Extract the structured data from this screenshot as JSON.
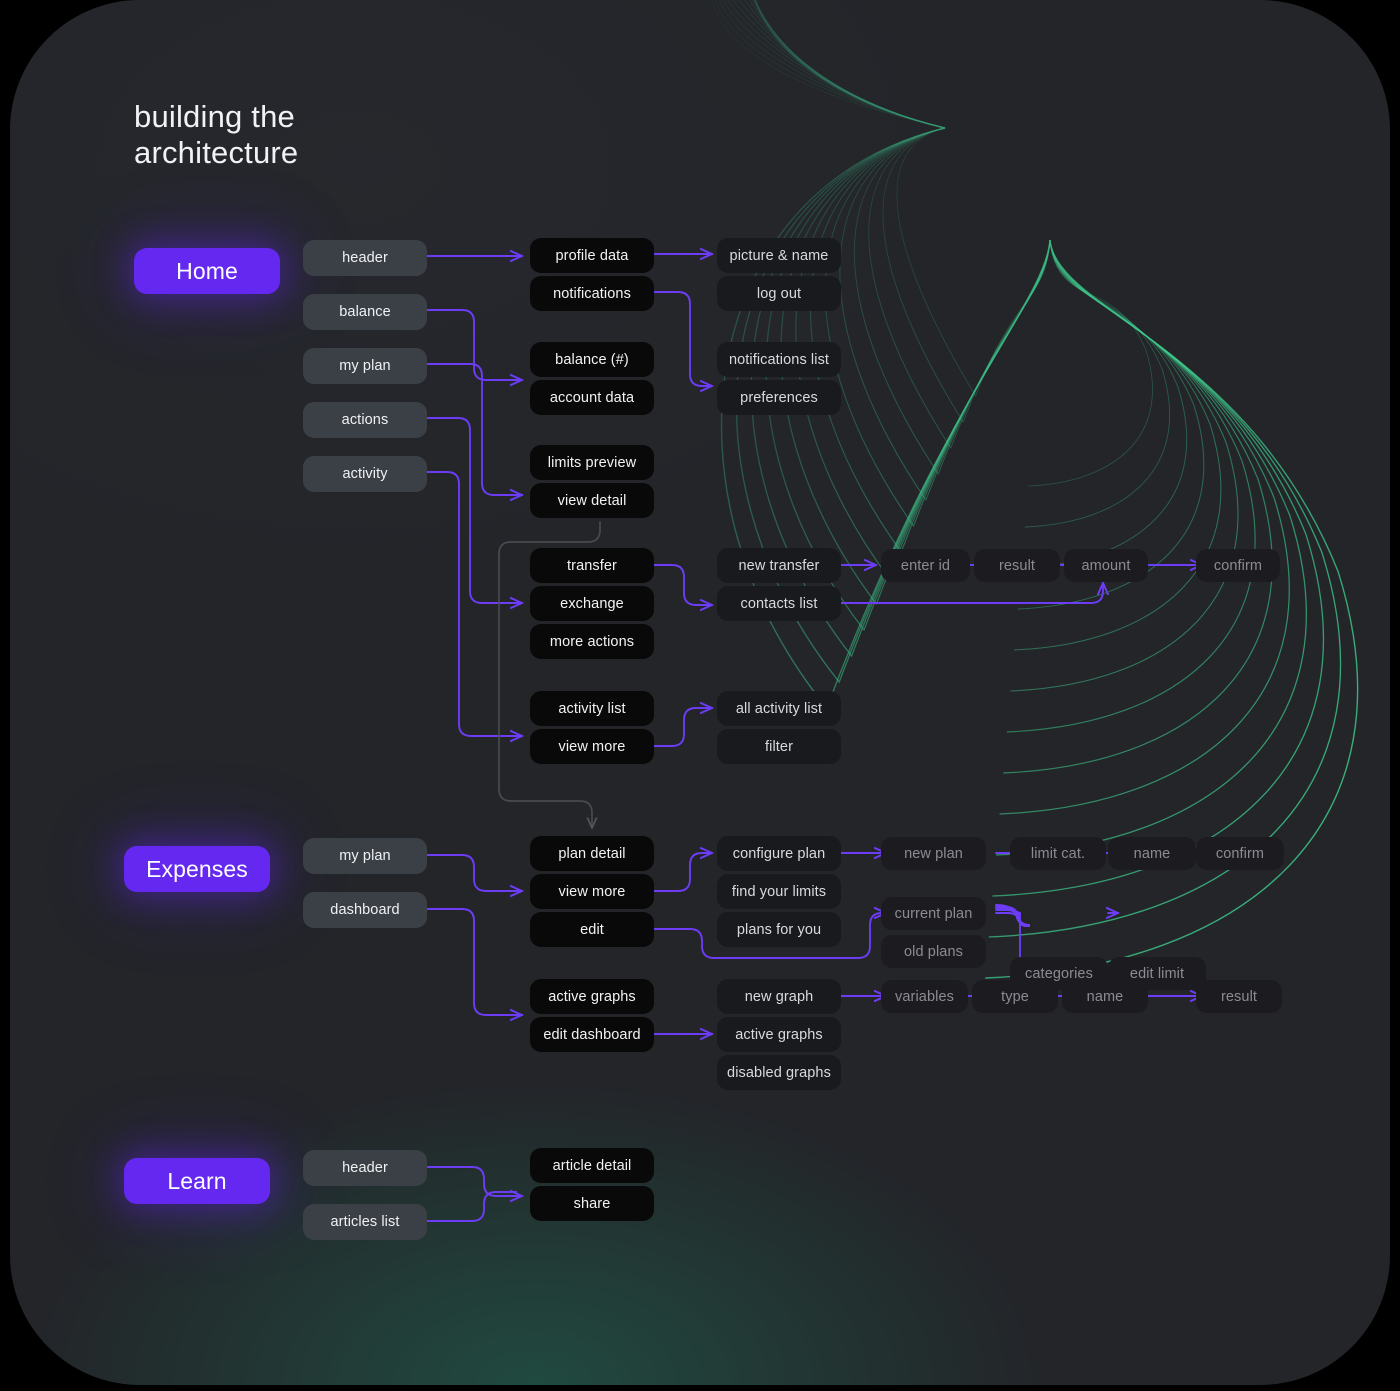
{
  "page": {
    "title": "building the\narchitecture",
    "accent_purple": "#6528f0",
    "accent_green": "#3ecf8e",
    "canvas_bg": "#232529"
  },
  "sections": [
    {
      "id": "home",
      "label": "Home"
    },
    {
      "id": "expenses",
      "label": "Expenses"
    },
    {
      "id": "learn",
      "label": "Learn"
    }
  ],
  "nodes": {
    "home": {
      "col2": [
        {
          "label": "header"
        },
        {
          "label": "balance"
        },
        {
          "label": "my plan"
        },
        {
          "label": "actions"
        },
        {
          "label": "activity"
        }
      ],
      "col3": [
        {
          "label": "profile data"
        },
        {
          "label": "notifications"
        },
        {
          "label": "balance (#)"
        },
        {
          "label": "account data"
        },
        {
          "label": "limits preview"
        },
        {
          "label": "view detail"
        },
        {
          "label": "transfer"
        },
        {
          "label": "exchange"
        },
        {
          "label": "more actions"
        },
        {
          "label": "activity list"
        },
        {
          "label": "view more"
        }
      ],
      "col4": [
        {
          "label": "picture & name"
        },
        {
          "label": "log out"
        },
        {
          "label": "notifications list"
        },
        {
          "label": "preferences"
        },
        {
          "label": "new transfer"
        },
        {
          "label": "contacts list"
        },
        {
          "label": "all activity list"
        },
        {
          "label": "filter"
        }
      ],
      "col5": [
        {
          "label": "enter id"
        },
        {
          "label": "result"
        },
        {
          "label": "amount"
        },
        {
          "label": "confirm"
        }
      ]
    },
    "expenses": {
      "col2": [
        {
          "label": "my plan"
        },
        {
          "label": "dashboard"
        }
      ],
      "col3": [
        {
          "label": "plan detail"
        },
        {
          "label": "view more"
        },
        {
          "label": "edit"
        },
        {
          "label": "active graphs"
        },
        {
          "label": "edit dashboard"
        }
      ],
      "col4": [
        {
          "label": "configure plan"
        },
        {
          "label": "find your limits"
        },
        {
          "label": "plans for you"
        },
        {
          "label": "new graph"
        },
        {
          "label": "active graphs"
        },
        {
          "label": "disabled graphs"
        }
      ],
      "col5": [
        {
          "label": "new plan"
        },
        {
          "label": "limit cat."
        },
        {
          "label": "name"
        },
        {
          "label": "confirm"
        },
        {
          "label": "current plan"
        },
        {
          "label": "old plans"
        },
        {
          "label": "categories"
        },
        {
          "label": "edit limit"
        },
        {
          "label": "variables"
        },
        {
          "label": "type"
        },
        {
          "label": "name"
        },
        {
          "label": "result"
        }
      ]
    },
    "learn": {
      "col2": [
        {
          "label": "header"
        },
        {
          "label": "articles list"
        }
      ],
      "col3": [
        {
          "label": "article detail"
        },
        {
          "label": "share"
        }
      ]
    }
  }
}
